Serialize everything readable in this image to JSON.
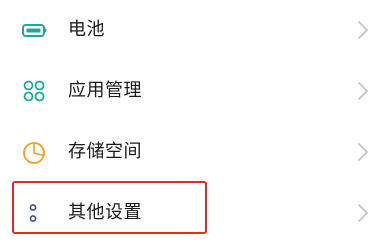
{
  "settings": {
    "items": [
      {
        "label": "电池",
        "icon": "battery-icon",
        "icon_color": "#1aa89a"
      },
      {
        "label": "应用管理",
        "icon": "app-grid-icon",
        "icon_color": "#1aa89a"
      },
      {
        "label": "存储空间",
        "icon": "storage-pie-icon",
        "icon_color": "#f0a026"
      },
      {
        "label": "其他设置",
        "icon": "more-dots-icon",
        "icon_color": "#3c4f86"
      }
    ],
    "chevron_icon": "chevron-right-icon"
  },
  "highlight": {
    "color": "#e02b2b",
    "target": "其他设置"
  }
}
